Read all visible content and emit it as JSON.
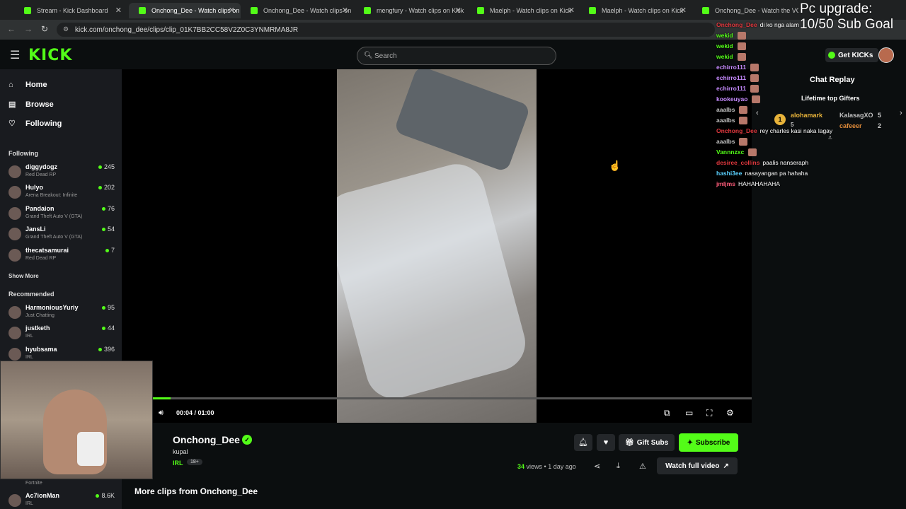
{
  "browser": {
    "tabs": [
      {
        "label": "Stream - Kick Dashboard",
        "active": false
      },
      {
        "label": "Onchong_Dee - Watch clips on",
        "active": true
      },
      {
        "label": "Onchong_Dee - Watch clips on",
        "active": false
      },
      {
        "label": "mengfury - Watch clips on Kick",
        "active": false
      },
      {
        "label": "Maelph - Watch clips on Kick",
        "active": false
      },
      {
        "label": "Maelph - Watch clips on Kick",
        "active": false
      },
      {
        "label": "Onchong_Dee - Watch the VOI",
        "active": false
      }
    ],
    "url": "kick.com/onchong_dee/clips/clip_01K7BB2CC58V2Z0C3YNMRMA8JR"
  },
  "header": {
    "logo": "KICK",
    "search_placeholder": "Search",
    "get_kicks_label": "Get KICKs"
  },
  "sidebar": {
    "nav": [
      "Home",
      "Browse",
      "Following"
    ],
    "following_title": "Following",
    "following": [
      {
        "name": "diggydogz",
        "game": "Red Dead RP",
        "viewers": "245"
      },
      {
        "name": "Hulyo",
        "game": "Arena Breakout: Infinite",
        "viewers": "202"
      },
      {
        "name": "Pandaion",
        "game": "Grand Theft Auto V (GTA)",
        "viewers": "76"
      },
      {
        "name": "JansLi",
        "game": "Grand Theft Auto V (GTA)",
        "viewers": "54"
      },
      {
        "name": "thecatsamurai",
        "game": "Red Dead RP",
        "viewers": "7"
      }
    ],
    "show_more": "Show More",
    "recommended_title": "Recommended",
    "recommended": [
      {
        "name": "HarmoniousYuriy",
        "game": "Just Chatting",
        "viewers": "95"
      },
      {
        "name": "justketh",
        "game": "IRL",
        "viewers": "44"
      },
      {
        "name": "hyubsama",
        "game": "IRL",
        "viewers": "396"
      }
    ],
    "bottom_partial_game": "Fortnite",
    "bottom_channel": {
      "name": "Ac7ionMan",
      "game": "IRL",
      "viewers": "8.6K"
    }
  },
  "player": {
    "time": "00:04 / 01:00",
    "progress": 0.03
  },
  "clip": {
    "channel": "Onchong_Dee",
    "title": "kupal",
    "category": "IRL",
    "badge": "18+",
    "gift_subs": "Gift Subs",
    "subscribe": "Subscribe",
    "views_count": "34",
    "views_suffix": "views • 1 day ago",
    "watch_full": "Watch full video",
    "more_clips": "More clips from Onchong_Dee"
  },
  "chat": {
    "title": "Chat Replay",
    "gifters_title": "Lifetime top Gifters",
    "gifters": [
      {
        "rank": "1",
        "name": "alohamark",
        "count": "5"
      },
      {
        "name": "KalasagXO",
        "count": "5"
      },
      {
        "name": "cafeeer",
        "count": "2"
      }
    ]
  },
  "stream_overlay": {
    "title_line1": "Pc upgrade:",
    "title_line2": "10/50 Sub Goal"
  },
  "overlay_chat": [
    {
      "user": "Onchong_Dee",
      "color": "#e0383e",
      "msg": "di ko nga alam"
    },
    {
      "user": "wekid",
      "color": "#53fc18",
      "msg": ""
    },
    {
      "user": "wekid",
      "color": "#53fc18",
      "msg": ""
    },
    {
      "user": "wekid",
      "color": "#53fc18",
      "msg": ""
    },
    {
      "user": "echirro111",
      "color": "#c78bff",
      "msg": ""
    },
    {
      "user": "echirro111",
      "color": "#c78bff",
      "msg": ""
    },
    {
      "user": "echirro111",
      "color": "#c78bff",
      "msg": ""
    },
    {
      "user": "kookeuyao",
      "color": "#c78bff",
      "msg": ""
    },
    {
      "user": "aaalbs",
      "color": "#c0c0c0",
      "msg": ""
    },
    {
      "user": "aaalbs",
      "color": "#c0c0c0",
      "msg": ""
    },
    {
      "user": "Onchong_Dee",
      "color": "#e0383e",
      "msg": "rey charles kasi naka lagay"
    },
    {
      "user": "aaalbs",
      "color": "#c0c0c0",
      "msg": ""
    },
    {
      "user": "Vannnzxc",
      "color": "#53fc18",
      "msg": ""
    },
    {
      "user": "desiree_collins",
      "color": "#e0383e",
      "msg": "paalis nanseraph"
    },
    {
      "user": "hashi3ee",
      "color": "#5ad1ff",
      "msg": "nasayangan pa hahaha"
    },
    {
      "user": "jmljms",
      "color": "#ff5c7a",
      "msg": "HAHAHAHAHA"
    }
  ]
}
